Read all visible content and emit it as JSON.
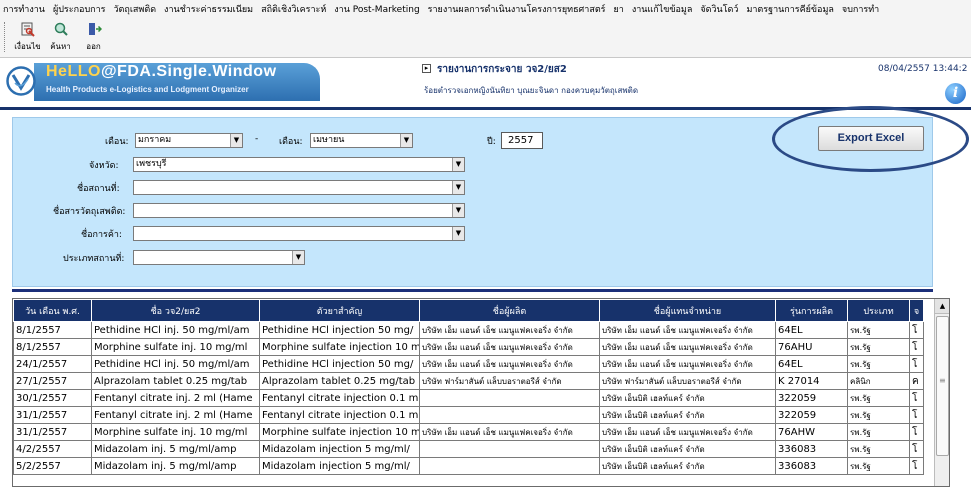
{
  "menu": [
    "การทำงาน",
    "ผู้ประกอบการ",
    "วัตถุเสพติด",
    "งานชำระค่าธรรมเนียม",
    "สถิติเชิงวิเคราะห์",
    "งาน Post-Marketing",
    "รายงานผลการดำเนินงานโครงการยุทธศาสตร์",
    "ยา",
    "งานแก้ไขข้อมูล",
    "จัดวินโดว์",
    "มาตรฐานการคีย์ข้อมูล",
    "จบการทำ"
  ],
  "toolbar": {
    "condition_label": "เงื่อนไข",
    "search_label": "ค้นหา",
    "exit_label": "ออก"
  },
  "banner": {
    "logo_title_hello": "HeLLO",
    "logo_title_rest": "@FDA.Single.Window",
    "logo_subtitle": "Health Products e-Logistics and Lodgment Organizer",
    "report_title": "รายงานการกระจาย วจ2/ยส2",
    "report_user": "ร้อยตำรวจเอกหญิงนันทิยา บุณยะจินดา กองควบคุมวัตถุเสพติด",
    "datetime": "08/04/2557 13:44:2"
  },
  "filter": {
    "month_from_label": "เดือน:",
    "month_from_value": "มกราคม",
    "dash": "-",
    "month_to_label": "เดือน:",
    "month_to_value": "เมษายน",
    "year_label": "ปี:",
    "year_value": "2557",
    "province_label": "จังหวัด:",
    "province_value": "เพชรบุรี",
    "place_label": "ชื่อสถานที่:",
    "place_value": "",
    "substance_label": "ชื่อสารวัตถุเสพติด:",
    "substance_value": "",
    "trade_label": "ชื่อการค้า:",
    "trade_value": "",
    "place_type_label": "ประเภทสถานที่:",
    "place_type_value": ""
  },
  "export_label": "Export Excel",
  "table": {
    "headers": [
      "วัน เดือน พ.ศ.",
      "ชื่อ วจ2/ยส2",
      "ตัวยาสำคัญ",
      "ชื่อผู้ผลิต",
      "ชื่อผู้แทนจำหน่าย",
      "รุ่นการผลิต",
      "ประเภท",
      "จ"
    ],
    "rows": [
      [
        "8/1/2557",
        "Pethidine HCl inj. 50 mg/ml/am",
        "Pethidine HCl injection 50 mg/",
        "บริษัท เอ็ม แอนด์ เอ็ช แมนูแฟคเจอริ่ง จำกัด",
        "บริษัท เอ็ม แอนด์ เอ็ช แมนูแฟคเจอริ่ง จำกัด",
        "64EL",
        "รพ.รัฐ",
        "โ"
      ],
      [
        "8/1/2557",
        "Morphine sulfate inj. 10 mg/ml",
        "Morphine sulfate injection 10 m",
        "บริษัท เอ็ม แอนด์ เอ็ช แมนูแฟคเจอริ่ง จำกัด",
        "บริษัท เอ็ม แอนด์ เอ็ช แมนูแฟคเจอริ่ง จำกัด",
        "76AHU",
        "รพ.รัฐ",
        "โ"
      ],
      [
        "24/1/2557",
        "Pethidine HCl inj. 50 mg/ml/am",
        "Pethidine HCl injection 50 mg/",
        "บริษัท เอ็ม แอนด์ เอ็ช แมนูแฟคเจอริ่ง จำกัด",
        "บริษัท เอ็ม แอนด์ เอ็ช แมนูแฟคเจอริ่ง จำกัด",
        "64EL",
        "รพ.รัฐ",
        "โ"
      ],
      [
        "27/1/2557",
        "Alprazolam tablet 0.25 mg/tab",
        "Alprazolam tablet 0.25 mg/tab",
        "บริษัท ฟาร์มาสันต์ แล็บบอราตอรีส์ จำกัด",
        "บริษัท ฟาร์มาสันต์ แล็บบอราตอรีส์ จำกัด",
        "K 27014",
        "คลินิก",
        "ค"
      ],
      [
        "30/1/2557",
        "Fentanyl citrate inj. 2 ml (Hame",
        "Fentanyl citrate injection 0.1 m",
        "",
        "บริษัท เอ็นบิติ เฮลท์แคร์ จำกัด",
        "322059",
        "รพ.รัฐ",
        "โ"
      ],
      [
        "31/1/2557",
        "Fentanyl citrate inj. 2 ml (Hame",
        "Fentanyl citrate injection 0.1 m",
        "",
        "บริษัท เอ็นบิติ เฮลท์แคร์ จำกัด",
        "322059",
        "รพ.รัฐ",
        "โ"
      ],
      [
        "31/1/2557",
        "Morphine sulfate inj. 10 mg/ml",
        "Morphine sulfate injection 10 m",
        "บริษัท เอ็ม แอนด์ เอ็ช แมนูแฟคเจอริ่ง จำกัด",
        "บริษัท เอ็ม แอนด์ เอ็ช แมนูแฟคเจอริ่ง จำกัด",
        "76AHW",
        "รพ.รัฐ",
        "โ"
      ],
      [
        "4/2/2557",
        "Midazolam inj. 5 mg/ml/amp",
        "Midazolam injection 5 mg/ml/",
        "",
        "บริษัท เอ็นบิติ เฮลท์แคร์ จำกัด",
        "336083",
        "รพ.รัฐ",
        "โ"
      ],
      [
        "5/2/2557",
        "Midazolam inj. 5 mg/ml/amp",
        "Midazolam injection 5 mg/ml/",
        "",
        "บริษัท เอ็นบิติ เฮลท์แคร์ จำกัด",
        "336083",
        "รพ.รัฐ",
        "โ"
      ]
    ]
  },
  "colors": {
    "header_navy": "#17326b",
    "filter_bg": "#c4e6fc",
    "annotation_ellipse": "#2b4a86"
  },
  "icons": [
    "condition-icon",
    "search-icon",
    "exit-icon",
    "fda-logo-icon",
    "report-arrow-icon",
    "info-icon",
    "dropdown-arrow-icon"
  ]
}
